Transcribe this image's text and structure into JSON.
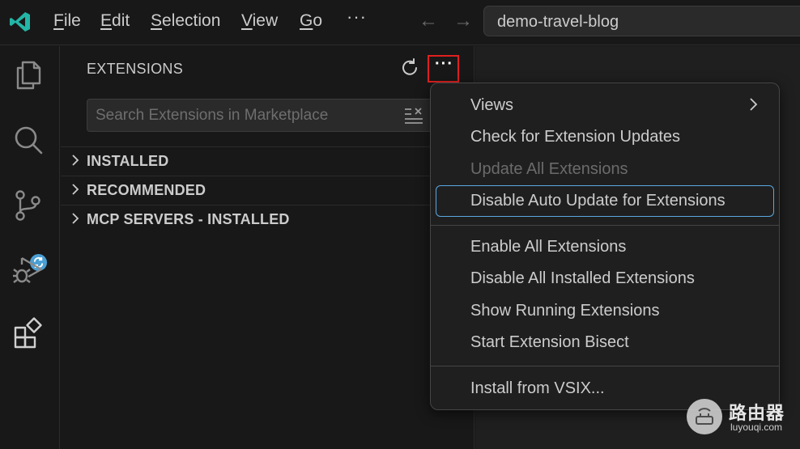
{
  "menubar": {
    "items": [
      {
        "label": "File",
        "mnemonic": "F",
        "rest": "ile"
      },
      {
        "label": "Edit",
        "mnemonic": "E",
        "rest": "dit"
      },
      {
        "label": "Selection",
        "mnemonic": "S",
        "rest": "election"
      },
      {
        "label": "View",
        "mnemonic": "V",
        "rest": "iew"
      },
      {
        "label": "Go",
        "mnemonic": "G",
        "rest": "o"
      }
    ],
    "more": "···",
    "back_glyph": "←",
    "forward_glyph": "→",
    "command_center": "demo-travel-blog"
  },
  "activitybar": {
    "icons": [
      "explorer-icon",
      "search-icon",
      "source-control-icon",
      "run-debug-icon",
      "extensions-icon"
    ],
    "accent": "#4a9fd4"
  },
  "sidebar": {
    "title": "EXTENSIONS",
    "more_label": "···",
    "search_placeholder": "Search Extensions in Marketplace",
    "sections": [
      {
        "label": "INSTALLED"
      },
      {
        "label": "RECOMMENDED"
      },
      {
        "label": "MCP SERVERS - INSTALLED"
      }
    ]
  },
  "context_menu": {
    "items": [
      {
        "label": "Views",
        "has_submenu": true,
        "disabled": false
      },
      {
        "label": "Check for Extension Updates",
        "disabled": false
      },
      {
        "label": "Update All Extensions",
        "disabled": true
      },
      {
        "label": "Disable Auto Update for Extensions",
        "disabled": false,
        "focused": true
      },
      {
        "label": "Enable All Extensions",
        "disabled": false
      },
      {
        "label": "Disable All Installed Extensions",
        "disabled": false
      },
      {
        "label": "Show Running Extensions",
        "disabled": false
      },
      {
        "label": "Start Extension Bisect",
        "disabled": false
      },
      {
        "label": "Install from VSIX...",
        "disabled": false
      }
    ],
    "focus_color": "#5aa7e0",
    "highlight_color": "#e02020"
  },
  "watermark": {
    "cn": "路由器",
    "en": "luyouqi.com"
  }
}
